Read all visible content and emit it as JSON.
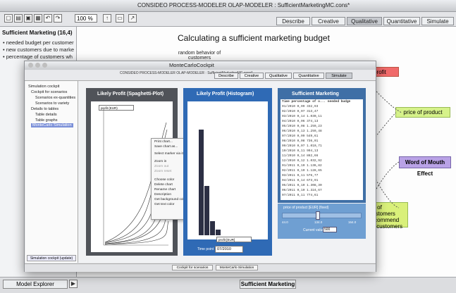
{
  "background_app": {
    "title": "CONSIDEO PROCESS-MODELER OLAP-MODELER : SufficientMarketingMC.cons*",
    "zoom": "100 %",
    "tabs": [
      "Describe",
      "Creative",
      "Qualitative",
      "Quantitative",
      "Simulate"
    ],
    "active_tab": "Qualitative",
    "sidebar": {
      "title": "Sufficient Marketing (16,4)",
      "items": [
        "needed budget per customer",
        "new customers due to marke",
        "percentage of customers wh"
      ]
    },
    "canvas": {
      "heading": "Calculating a sufficient marketing budget",
      "note": "random behavior of customers",
      "nodes": {
        "profit": "profit",
        "price_of_product": "price of product",
        "word_of_mouth": "Word of Mouth Effect",
        "customers_note": [
          "ge of customers",
          "recommend",
          "all customers"
        ]
      }
    },
    "footer": {
      "model_explorer": "Model Explorer",
      "sufficient_marketing": "Sufficient Marketing"
    }
  },
  "foreground_window": {
    "title": "MonteCarloCockpit",
    "subtitle": "CONSIDEO PROCESS-MODELER OLAP-MODELER : SufficientMarketingMC.cons*",
    "tabs": [
      "Describe",
      "Creative",
      "Qualitative",
      "Quantitative",
      "Simulate"
    ],
    "active_tab": "Simulate",
    "tree": [
      "Simulation cockpit",
      "Cockpit for scenarios",
      "Scenarios ex-quantities",
      "Scenarios to variety",
      "Details to tables",
      "Table details",
      "Table graphs",
      "MonteCarlo Simulation"
    ],
    "sidebar_button": "Simulation cockpit (update)",
    "panels": {
      "spaghetti": "Likely Profit (Spaghetti-Plot)",
      "histogram": "Likely Profit (Histogram)",
      "table": "Sufficient Marketing"
    },
    "spaghetti_legend": "profit (EUR)",
    "histogram_legend": "profit [EUR]",
    "date_label": "Time point",
    "date_value": "07/2010",
    "table_headers": [
      "Time",
      "percentage of o...",
      "needed budge"
    ],
    "table_rows": [
      [
        "01/2010",
        "0,09",
        "332,93"
      ],
      [
        "02/2010",
        "0,07",
        "313,47"
      ],
      [
        "03/2010",
        "0,14",
        "1.030,11"
      ],
      [
        "04/2010",
        "0,06",
        "374,13"
      ],
      [
        "05/2010",
        "0,08",
        "1.259,23"
      ],
      [
        "06/2010",
        "0,13",
        "1.259,48"
      ],
      [
        "07/2010",
        "0,09",
        "549,61"
      ],
      [
        "08/2010",
        "0,08",
        "736,01"
      ],
      [
        "09/2010",
        "0,07",
        "1.010,71"
      ],
      [
        "10/2010",
        "0,11",
        "994,13"
      ],
      [
        "11/2010",
        "0,14",
        "862,66"
      ],
      [
        "12/2010",
        "0,12",
        "1.032,92"
      ],
      [
        "01/2011",
        "0,10",
        "1.136,82"
      ],
      [
        "02/2011",
        "0,10",
        "1.128,65"
      ],
      [
        "03/2011",
        "0,11",
        "576,77"
      ],
      [
        "04/2011",
        "0,14",
        "673,91"
      ],
      [
        "05/2011",
        "0,10",
        "1.308,30"
      ],
      [
        "06/2011",
        "0,10",
        "1.324,67"
      ],
      [
        "07/2011",
        "0,11",
        "774,61"
      ]
    ],
    "slider": {
      "title": "price of product [EUR] (fixed)",
      "min": "44.0",
      "mid": "134.0",
      "max": "164.0",
      "current_label": "Current value",
      "current_value": "500"
    },
    "context_menu": [
      "Print chart...",
      "Save chart as...",
      "Select marker via its name",
      "Zoom in",
      "Zoom out",
      "Zoom reset",
      "Choose color",
      "Delete chart",
      "Rename chart",
      "Description",
      "Get background color",
      "Get text color"
    ],
    "footer_buttons": [
      "Cockpit for scenarios",
      "MonteCarlo Simulation"
    ]
  },
  "colors": {
    "profit_node": "#f06a6a",
    "price_node": "#d6f28a",
    "word_of_mouth_node": "#b9a2e6",
    "customers_node": "#d9f07a",
    "table_panel": "#3f6fa6",
    "slider_panel": "#6f9fd2"
  }
}
